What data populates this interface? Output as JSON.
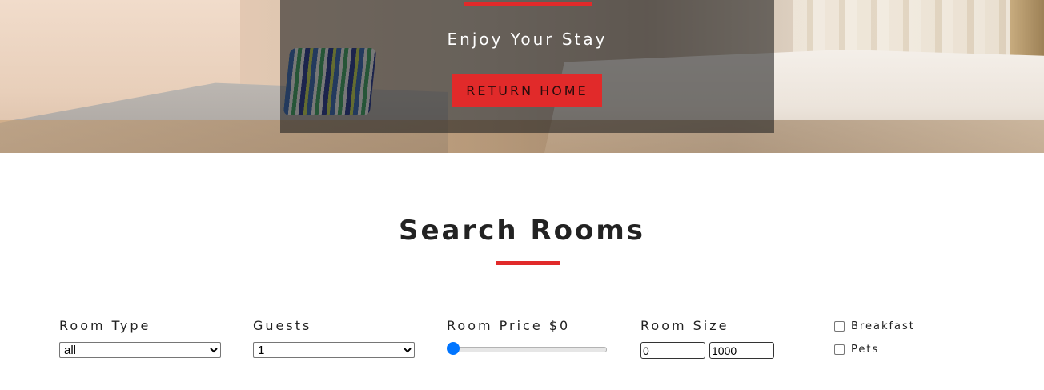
{
  "hero": {
    "tagline": "Enjoy Your Stay",
    "return_button": "RETURN HOME",
    "accent_color": "#e12a2a"
  },
  "search": {
    "title": "Search Rooms",
    "room_type": {
      "label": "Room Type",
      "selected": "all"
    },
    "guests": {
      "label": "Guests",
      "selected": "1"
    },
    "room_price": {
      "label": "Room Price $0",
      "slider_fraction": 0
    },
    "room_size": {
      "label": "Room Size",
      "min_value": "0",
      "max_value": "1000"
    },
    "breakfast": {
      "label": "Breakfast",
      "checked": false
    },
    "pets": {
      "label": "Pets",
      "checked": false
    }
  }
}
